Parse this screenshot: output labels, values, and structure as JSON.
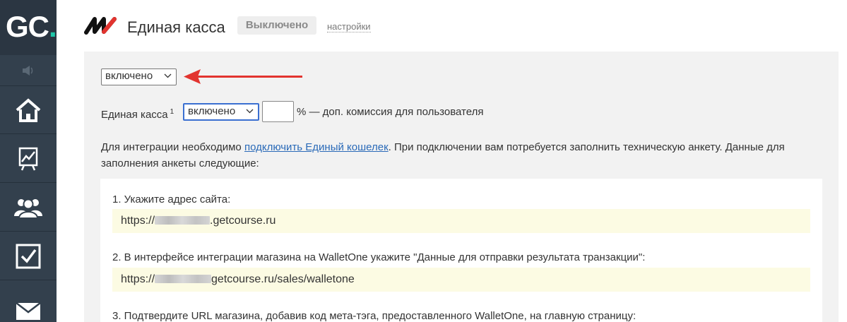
{
  "app": {
    "logo_text": "GC",
    "logo_dot": "."
  },
  "sidebar": {
    "items": [
      {
        "name": "home",
        "icon": "home-icon"
      },
      {
        "name": "stats",
        "icon": "chart-icon"
      },
      {
        "name": "users",
        "icon": "users-icon"
      },
      {
        "name": "tasks",
        "icon": "checkbox-icon"
      },
      {
        "name": "mail",
        "icon": "envelope-icon"
      }
    ]
  },
  "header": {
    "title": "Единая касса",
    "status": "Выключено",
    "settings_link": "настройки"
  },
  "form": {
    "main_select": {
      "value": "включено",
      "options": [
        "включено"
      ]
    },
    "kassa_label": "Единая касса",
    "kassa_sup": "1",
    "kassa_select": {
      "value": "включено"
    },
    "commission_input": {
      "value": ""
    },
    "commission_suffix": "% — доп. комиссия для пользователя"
  },
  "intro": {
    "text_before": "Для интеграции необходимо ",
    "link": "подключить Единый кошелек",
    "text_after": ". При подключении вам потребуется заполнить техническую анкету. Данные для заполнения анкеты следующие:"
  },
  "steps": [
    {
      "label": "1. Укажите адрес сайта:",
      "url_prefix": "https://",
      "url_suffix": ".getcourse.ru"
    },
    {
      "label": "2. В интерфейсе интеграции магазина на WalletOne укажите \"Данные для отправки результата транзакции\":",
      "url_prefix": "https://",
      "url_suffix": "getcourse.ru/sales/walletone"
    },
    {
      "label": "3. Подтвердите URL магазина, добавив код мета-тэга, предоставленного WalletOne, на главную страницу:"
    }
  ],
  "colors": {
    "sidebar": "#33404d",
    "accent": "#1fc7a9",
    "arrow": "#e2342f",
    "link": "#2a6ab8",
    "url_highlight": "#fcfbe3"
  }
}
